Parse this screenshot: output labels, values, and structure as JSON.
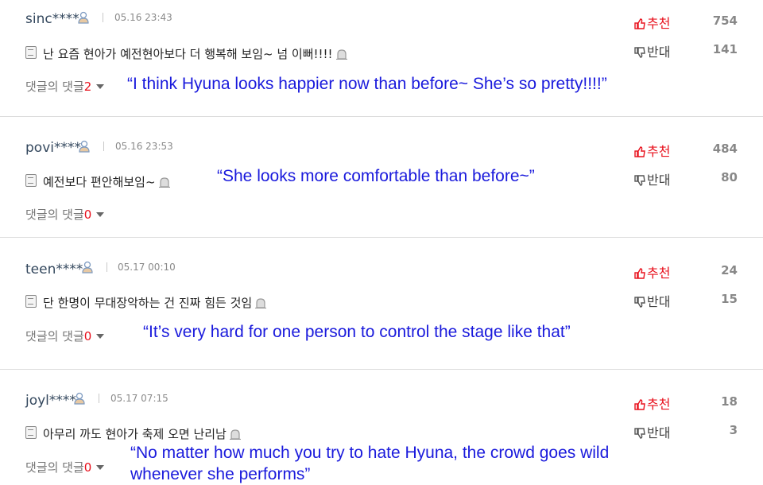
{
  "labels": {
    "replies": "댓글의 댓글",
    "up": "추천",
    "down": "반대"
  },
  "colors": {
    "translation": "#1a1adc",
    "accent_red": "#e8101c",
    "username": "#34485e"
  },
  "comments": [
    {
      "user": "sinc****",
      "time": "05.16 23:43",
      "text": "난 요즘 현아가 예전현아보다 더 행복해 보임~ 넘 이뻐!!!!",
      "replies": "2",
      "up": "754",
      "down": "141",
      "translation": "“I think Hyuna looks happier now than before~ She’s so pretty!!!!”",
      "translation2": ""
    },
    {
      "user": "povi****",
      "time": "05.16 23:53",
      "text": "예전보다 편안해보임~",
      "replies": "0",
      "up": "484",
      "down": "80",
      "translation": "“She looks more comfortable than before~”",
      "translation2": ""
    },
    {
      "user": "teen****",
      "time": "05.17 00:10",
      "text": "단 한명이 무대장악하는 건 진짜 힘든 것임",
      "replies": "0",
      "up": "24",
      "down": "15",
      "translation": "“It’s very hard for one person to control the stage like that”",
      "translation2": ""
    },
    {
      "user": "joyl****",
      "time": "05.17 07:15",
      "text": "아무리 까도 현아가 축제 오면 난리남",
      "replies": "0",
      "up": "18",
      "down": "3",
      "translation": "“No matter how much you try to hate Hyuna, the crowd goes wild",
      "translation2": "whenever she performs”"
    }
  ]
}
